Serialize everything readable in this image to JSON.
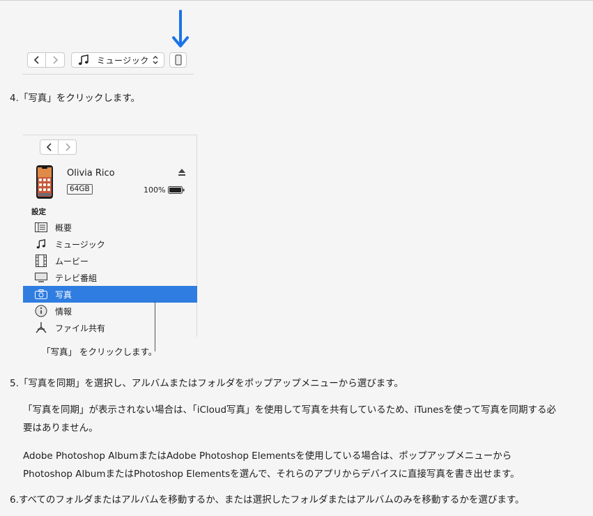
{
  "figure1": {
    "source_menu_label": "ミュージック",
    "icons": [
      "back-chevron-icon",
      "forward-chevron-icon",
      "music-note-icon",
      "updown-chevron-icon",
      "iphone-device-icon",
      "down-arrow-icon"
    ],
    "accent_color": "#1a73e8"
  },
  "steps": {
    "step4": {
      "num": "4.",
      "text": "「写真」をクリックします。"
    },
    "step5": {
      "num": "5.",
      "text": "「写真を同期」を選択し、アルバムまたはフォルダをポップアップメニューから選びます。"
    },
    "step6": {
      "num": "6.",
      "text": "すべてのフォルダまたはアルバムを移動するか、または選択したフォルダまたはアルバムのみを移動するかを選びます。"
    }
  },
  "notes": {
    "note1": {
      "line1": "「写真を同期」が表示されない場合は、「iCloud写真」を使用して写真を共有しているため、iTunesを使って写真を同期する必",
      "line2": "要はありません。"
    },
    "note2": {
      "line1": "Adobe Photoshop AlbumまたはAdobe Photoshop Elementsを使用している場合は、ポップアップメニューから",
      "line2": "Photoshop AlbumまたはPhotoshop Elementsを選んで、それらのアプリからデバイスに直接写真を書き出せます。"
    }
  },
  "figure2": {
    "device_name": "Olivia Rico",
    "capacity": "64GB",
    "battery": "100%",
    "settings_heading": "設定",
    "items": [
      {
        "label": "概要",
        "icon": "summary-list-icon"
      },
      {
        "label": "ミュージック",
        "icon": "music-note-icon"
      },
      {
        "label": "ムービー",
        "icon": "film-icon"
      },
      {
        "label": "テレビ番組",
        "icon": "tv-icon"
      },
      {
        "label": "写真",
        "icon": "camera-icon",
        "selected": true
      },
      {
        "label": "情報",
        "icon": "info-icon"
      },
      {
        "label": "ファイル共有",
        "icon": "file-sharing-icon"
      }
    ],
    "callout": "「写真」 をクリックします。",
    "selection_color": "#2f7de1"
  }
}
